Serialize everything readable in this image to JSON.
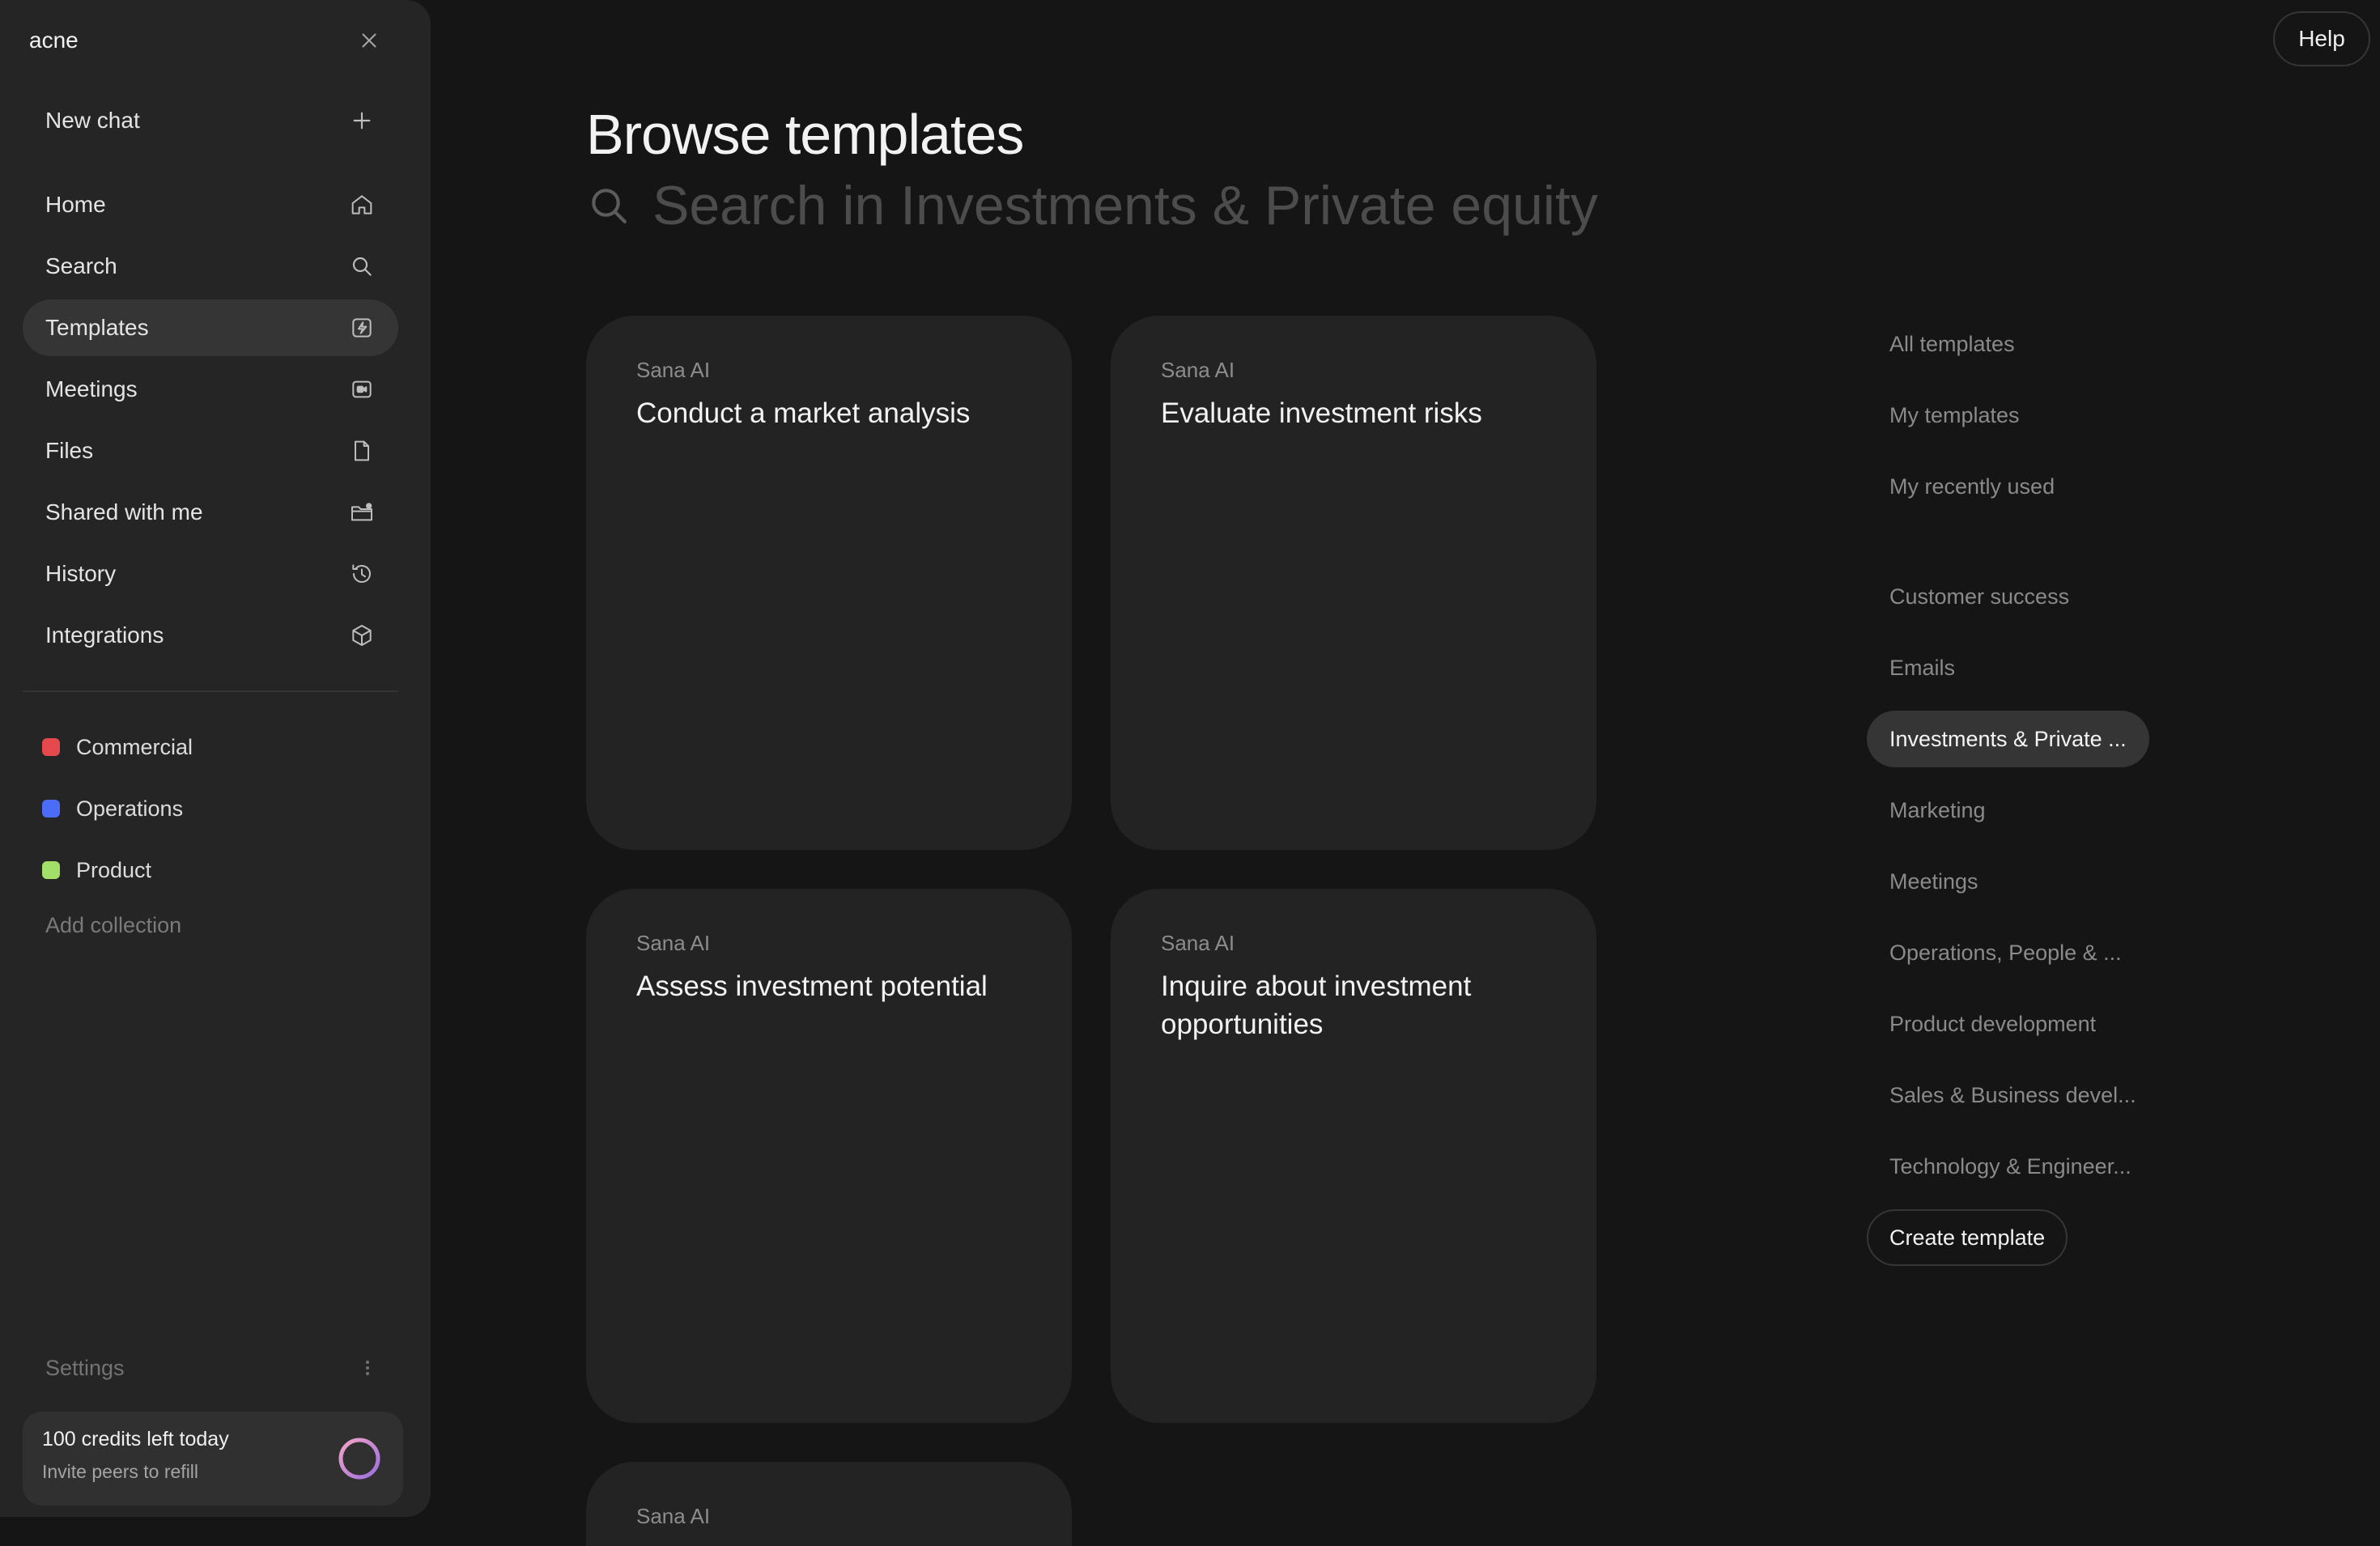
{
  "sidebar": {
    "workspace": "acne",
    "new_chat": "New chat",
    "nav": [
      {
        "label": "Home",
        "icon": "home-icon"
      },
      {
        "label": "Search",
        "icon": "search-icon"
      },
      {
        "label": "Templates",
        "icon": "lightning-icon"
      },
      {
        "label": "Meetings",
        "icon": "video-icon"
      },
      {
        "label": "Files",
        "icon": "file-icon"
      },
      {
        "label": "Shared with me",
        "icon": "shared-folder-icon"
      },
      {
        "label": "History",
        "icon": "history-icon"
      },
      {
        "label": "Integrations",
        "icon": "cube-icon"
      }
    ],
    "active_nav": "Templates",
    "collections": [
      {
        "label": "Commercial",
        "color": "#e5484d"
      },
      {
        "label": "Operations",
        "color": "#4a6cf7"
      },
      {
        "label": "Product",
        "color": "#a3e06a"
      }
    ],
    "add_collection": "Add collection",
    "settings": "Settings",
    "credits": {
      "title": "100 credits left today",
      "subtitle": "Invite peers to refill"
    }
  },
  "header": {
    "help": "Help"
  },
  "main": {
    "title": "Browse templates",
    "search_placeholder": "Search in Investments & Private equity",
    "cards": [
      {
        "source": "Sana AI",
        "title": "Conduct a market analysis"
      },
      {
        "source": "Sana AI",
        "title": "Evaluate investment risks"
      },
      {
        "source": "Sana AI",
        "title": "Assess investment potential"
      },
      {
        "source": "Sana AI",
        "title": "Inquire about investment opportunities"
      },
      {
        "source": "Sana AI",
        "title": ""
      }
    ]
  },
  "categories": {
    "primary": [
      "All templates",
      "My templates",
      "My recently used"
    ],
    "topics": [
      "Customer success",
      "Emails",
      "Investments & Private ...",
      "Marketing",
      "Meetings",
      "Operations, People & ...",
      "Product development",
      "Sales & Business devel...",
      "Technology & Engineer..."
    ],
    "active": "Investments & Private ...",
    "create_label": "Create template"
  },
  "colors": {
    "background": "#151515",
    "sidebar": "#252526",
    "card": "#232324",
    "active_pill": "#353536",
    "credits_ring": [
      "#f4a3c4",
      "#9b6fe0"
    ]
  }
}
